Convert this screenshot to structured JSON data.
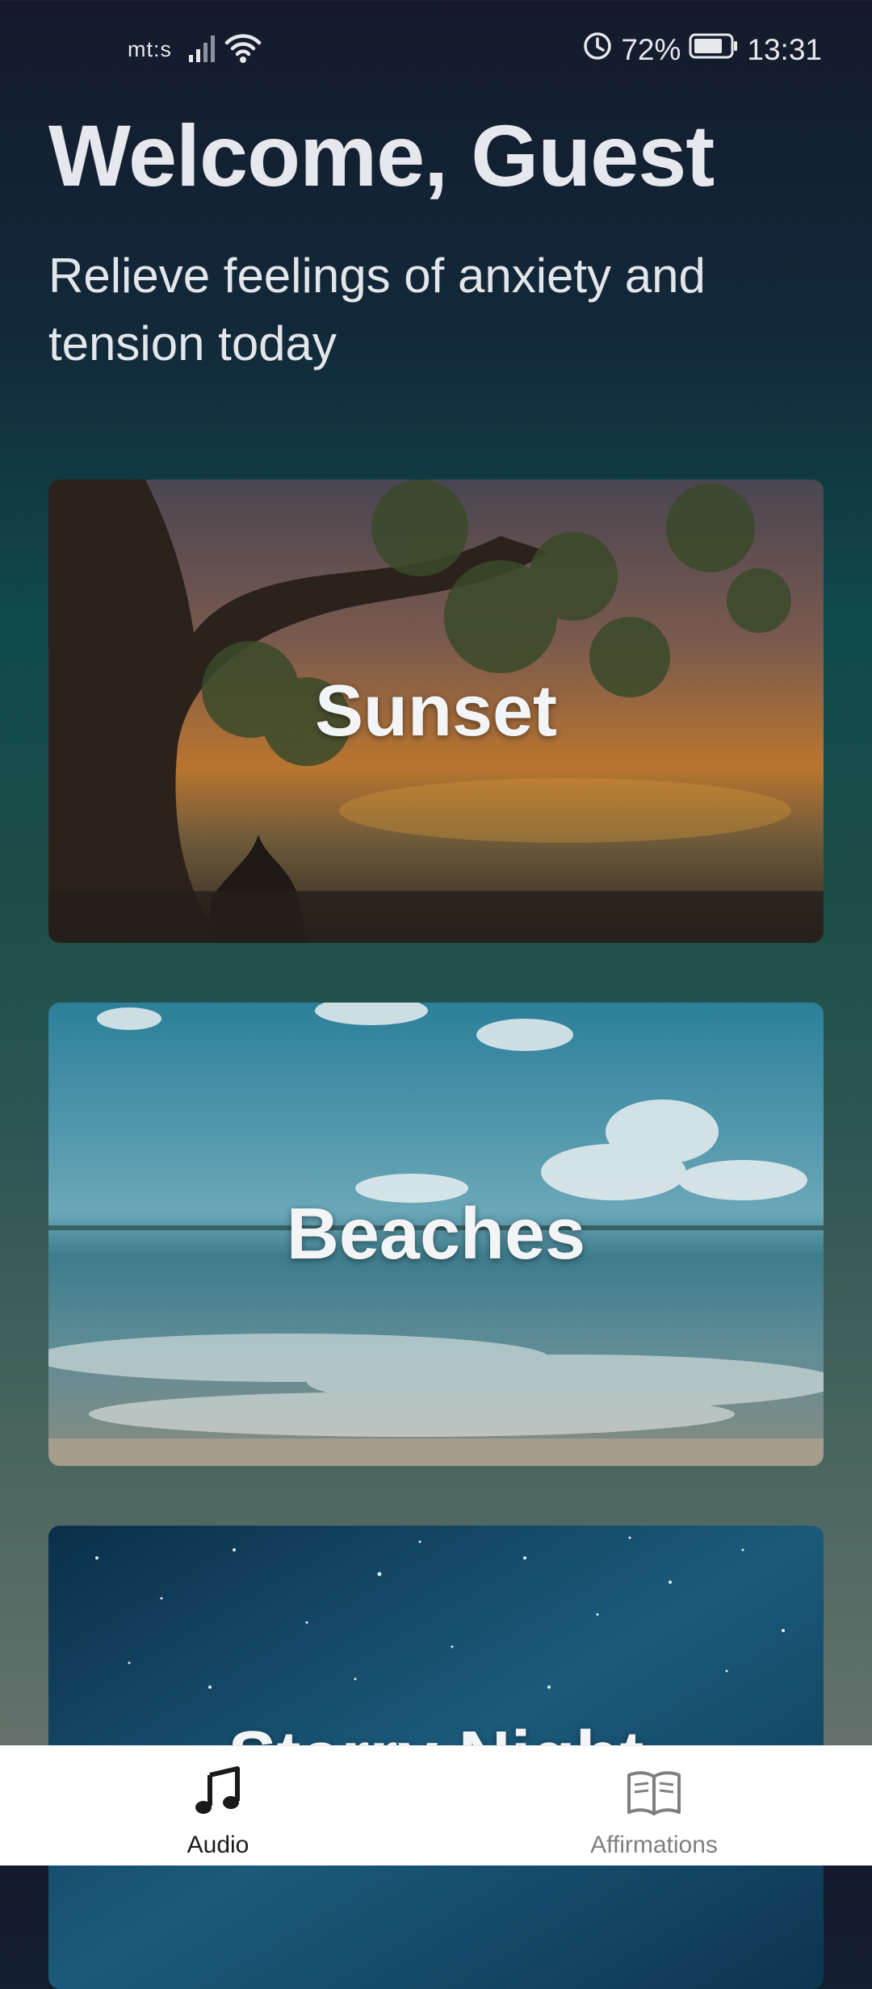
{
  "status_bar": {
    "carrier": "mt:s",
    "battery": "72%",
    "time": "13:31"
  },
  "header": {
    "title": "Welcome, Guest",
    "subtitle": "Relieve feelings of anxiety and tension today"
  },
  "cards": [
    {
      "label": "Sunset"
    },
    {
      "label": "Beaches"
    },
    {
      "label": "Starry Night"
    }
  ],
  "bottom_nav": {
    "items": [
      {
        "label": "Audio",
        "icon": "music-note-icon",
        "active": true
      },
      {
        "label": "Affirmations",
        "icon": "book-icon",
        "active": false
      }
    ]
  },
  "colors": {
    "background_top": "#141a2b",
    "background_mid": "#0f4a4a",
    "background_bottom": "#6f7570",
    "nav_active": "#1a1a1a",
    "nav_inactive": "#7f7f7f"
  }
}
